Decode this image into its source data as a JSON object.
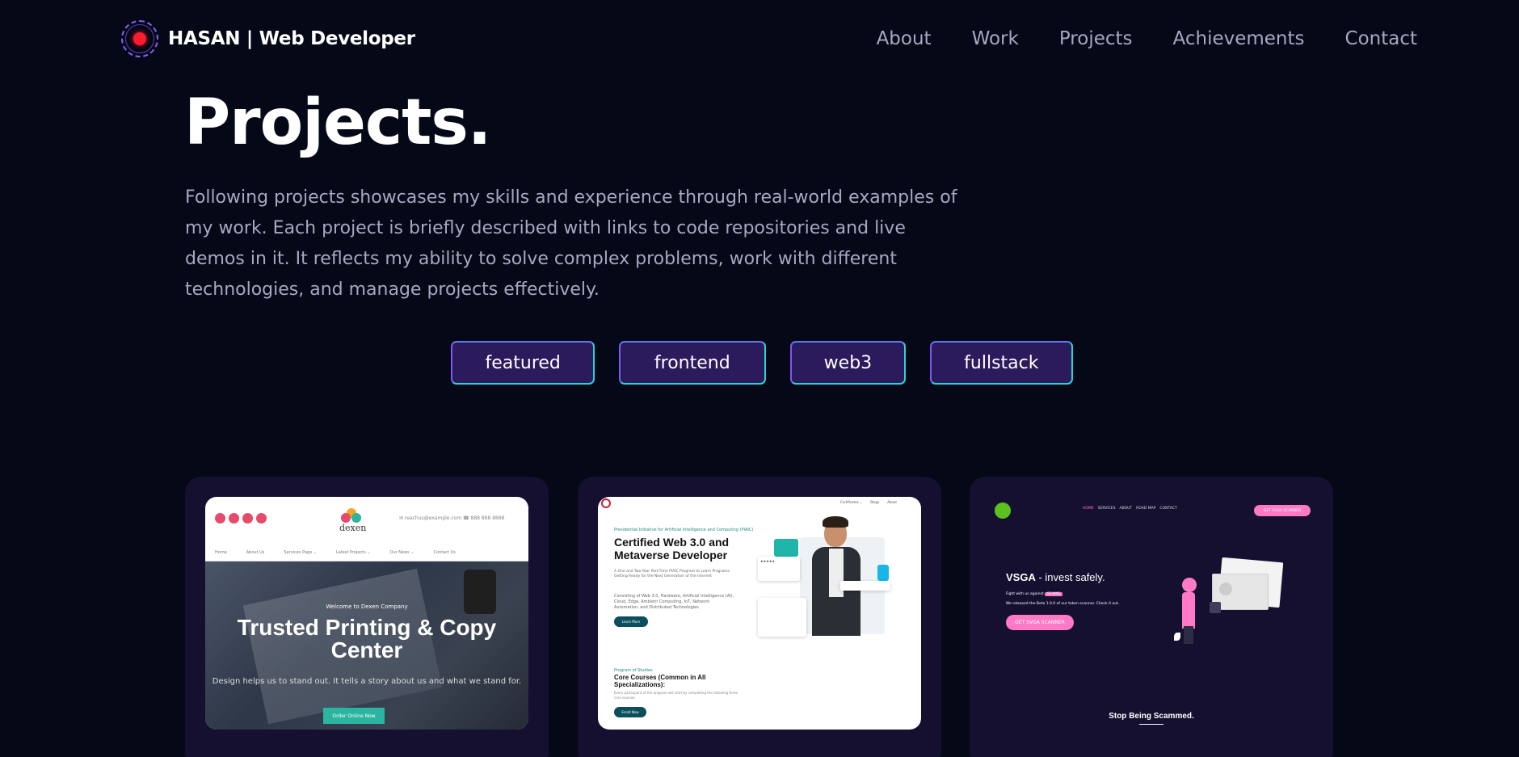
{
  "nav": {
    "brand": "HASAN  | Web Developer",
    "links": [
      "About",
      "Work",
      "Projects",
      "Achievements",
      "Contact"
    ]
  },
  "hero": {
    "title": "Projects.",
    "description": "Following projects showcases my skills and experience through real-world examples of my work. Each project is briefly described with links to code repositories and live demos in it. It reflects my ability to solve complex problems, work with different technologies, and manage projects effectively."
  },
  "filters": [
    "featured",
    "frontend",
    "web3",
    "fullstack"
  ],
  "colors": {
    "background": "#050816",
    "card": "#151030",
    "filter_bg": "#2b1a5c",
    "filter_border": "#2dd4d4",
    "muted_text": "#aaa6c3",
    "accent_pink": "#ff79c6"
  },
  "projects": [
    {
      "company": "dexen",
      "welcome": "Welcome to Dexen Company",
      "headline": "Trusted Printing & Copy Center",
      "subtitle": "Design helps us to stand out. It tells a story about us and what we stand for.",
      "cta": "Order Online Now",
      "contact": "✉ reachus@example.com   ☎ 888 888 8888",
      "menu": [
        "Home",
        "About Us",
        "Services Page ⌄",
        "Latest Projects ⌄",
        "Our News ⌄",
        "Contact Us"
      ]
    },
    {
      "tag": "Presidential Initiative for Artificial Intelligence and Computing (PIAIC)",
      "headline": "Certified Web 3.0 and Metaverse Developer",
      "intro": "A One and Two-Year Part-Time PIAIC Program to Learn Programs Getting Ready for the Next Generation of the Internet",
      "text": "Consisting of Web 3.0, Hardware, Artificial Intelligence (AI), Cloud, Edge, Ambient Computing, IoT, Network Automation, and Distributed Technologies",
      "cta": "Learn More",
      "tag2": "Program of Studies",
      "headline2": "Core Courses (Common in All Specializations):",
      "text2": "Every participant of the program will start by completing the following three core courses:",
      "cta2": "Enroll Now",
      "menu": [
        "Certificates ⌄",
        "Blogs",
        "About"
      ]
    },
    {
      "menu": [
        "HOME",
        "SERVICES",
        "ABOUT",
        "ROAD MAP",
        "CONTACT"
      ],
      "top_cta": "GET SVGA SCANNER",
      "headline_a": "VSGA",
      "headline_b": " - invest safely.",
      "fight_text": "Fight with us against",
      "fight_tag": "SCAMS",
      "release_text": "We released the Beta 1.0.0 of our token-scanner. Check it out.",
      "cta": "GET SVGA SCANNER",
      "footer": "Stop Being Scammed."
    }
  ]
}
